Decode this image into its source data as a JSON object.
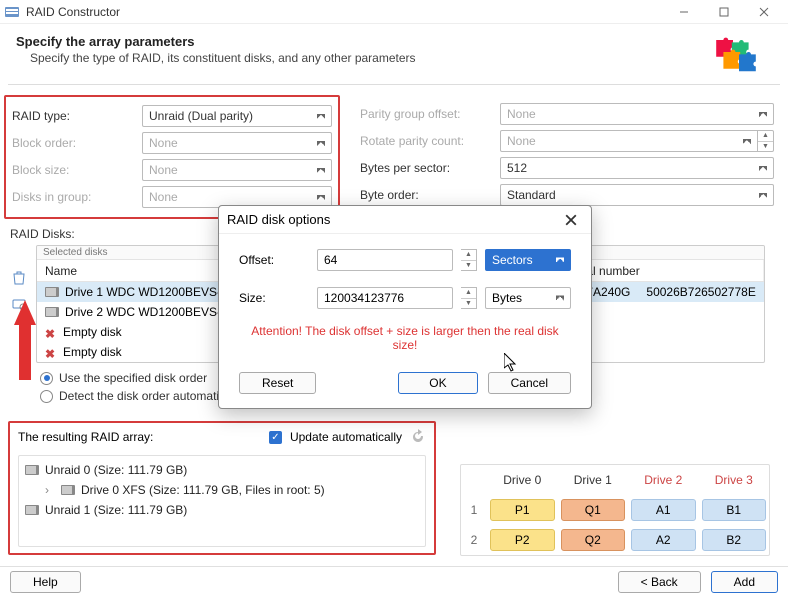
{
  "titlebar": {
    "title": "RAID Constructor"
  },
  "header": {
    "title": "Specify the array parameters",
    "subtitle": "Specify the type of RAID, its constituent disks, and any other parameters"
  },
  "params_left": {
    "raid_type": {
      "label": "RAID type:",
      "value": "Unraid (Dual parity)"
    },
    "block_order": {
      "label": "Block order:",
      "value": "None"
    },
    "block_size": {
      "label": "Block size:",
      "value": "None"
    },
    "disks_in_group": {
      "label": "Disks in group:",
      "value": "None"
    }
  },
  "params_right": {
    "parity_offset": {
      "label": "Parity group offset:",
      "value": "None"
    },
    "rotate_parity": {
      "label": "Rotate parity count:",
      "value": "None"
    },
    "bytes_sector": {
      "label": "Bytes per sector:",
      "value": "512"
    },
    "byte_order": {
      "label": "Byte order:",
      "value": "Standard"
    }
  },
  "disks": {
    "label": "RAID Disks:",
    "selected_label": "Selected disks",
    "cols": {
      "name": "Name",
      "serial": "Serial number"
    },
    "rows": [
      {
        "name": "Drive 1 WDC WD1200BEVS-22UST0",
        "extra": "0S37A240G",
        "serial": "50026B726502778E",
        "empty": false
      },
      {
        "name": "Drive 2 WDC WD1200BEVS-22UST0",
        "extra": "",
        "serial": "",
        "empty": false
      },
      {
        "name": "Empty disk",
        "empty": true
      },
      {
        "name": "Empty disk",
        "empty": true
      }
    ],
    "radio": {
      "specified": "Use the specified disk order",
      "auto": "Detect the disk order automatically"
    }
  },
  "result": {
    "label": "The resulting RAID array:",
    "update_label": "Update automatically",
    "items": [
      "Unraid 0 (Size: 111.79 GB)",
      "Drive 0 XFS (Size: 111.79 GB, Files in root: 5)",
      "Unraid 1 (Size: 111.79 GB)"
    ]
  },
  "grid": {
    "heads": [
      "Drive 0",
      "Drive 1",
      "Drive 2",
      "Drive 3"
    ],
    "rows": [
      {
        "n": "1",
        "cells": [
          "P1",
          "Q1",
          "A1",
          "B1"
        ]
      },
      {
        "n": "2",
        "cells": [
          "P2",
          "Q2",
          "A2",
          "B2"
        ]
      }
    ]
  },
  "bottom": {
    "help": "Help",
    "back": "< Back",
    "add": "Add"
  },
  "modal": {
    "title": "RAID disk options",
    "offset": {
      "label": "Offset:",
      "value": "64",
      "unit": "Sectors"
    },
    "size": {
      "label": "Size:",
      "value": "120034123776",
      "unit": "Bytes"
    },
    "warn": "Attention! The disk offset + size is larger then the real disk size!",
    "reset": "Reset",
    "ok": "OK",
    "cancel": "Cancel"
  }
}
